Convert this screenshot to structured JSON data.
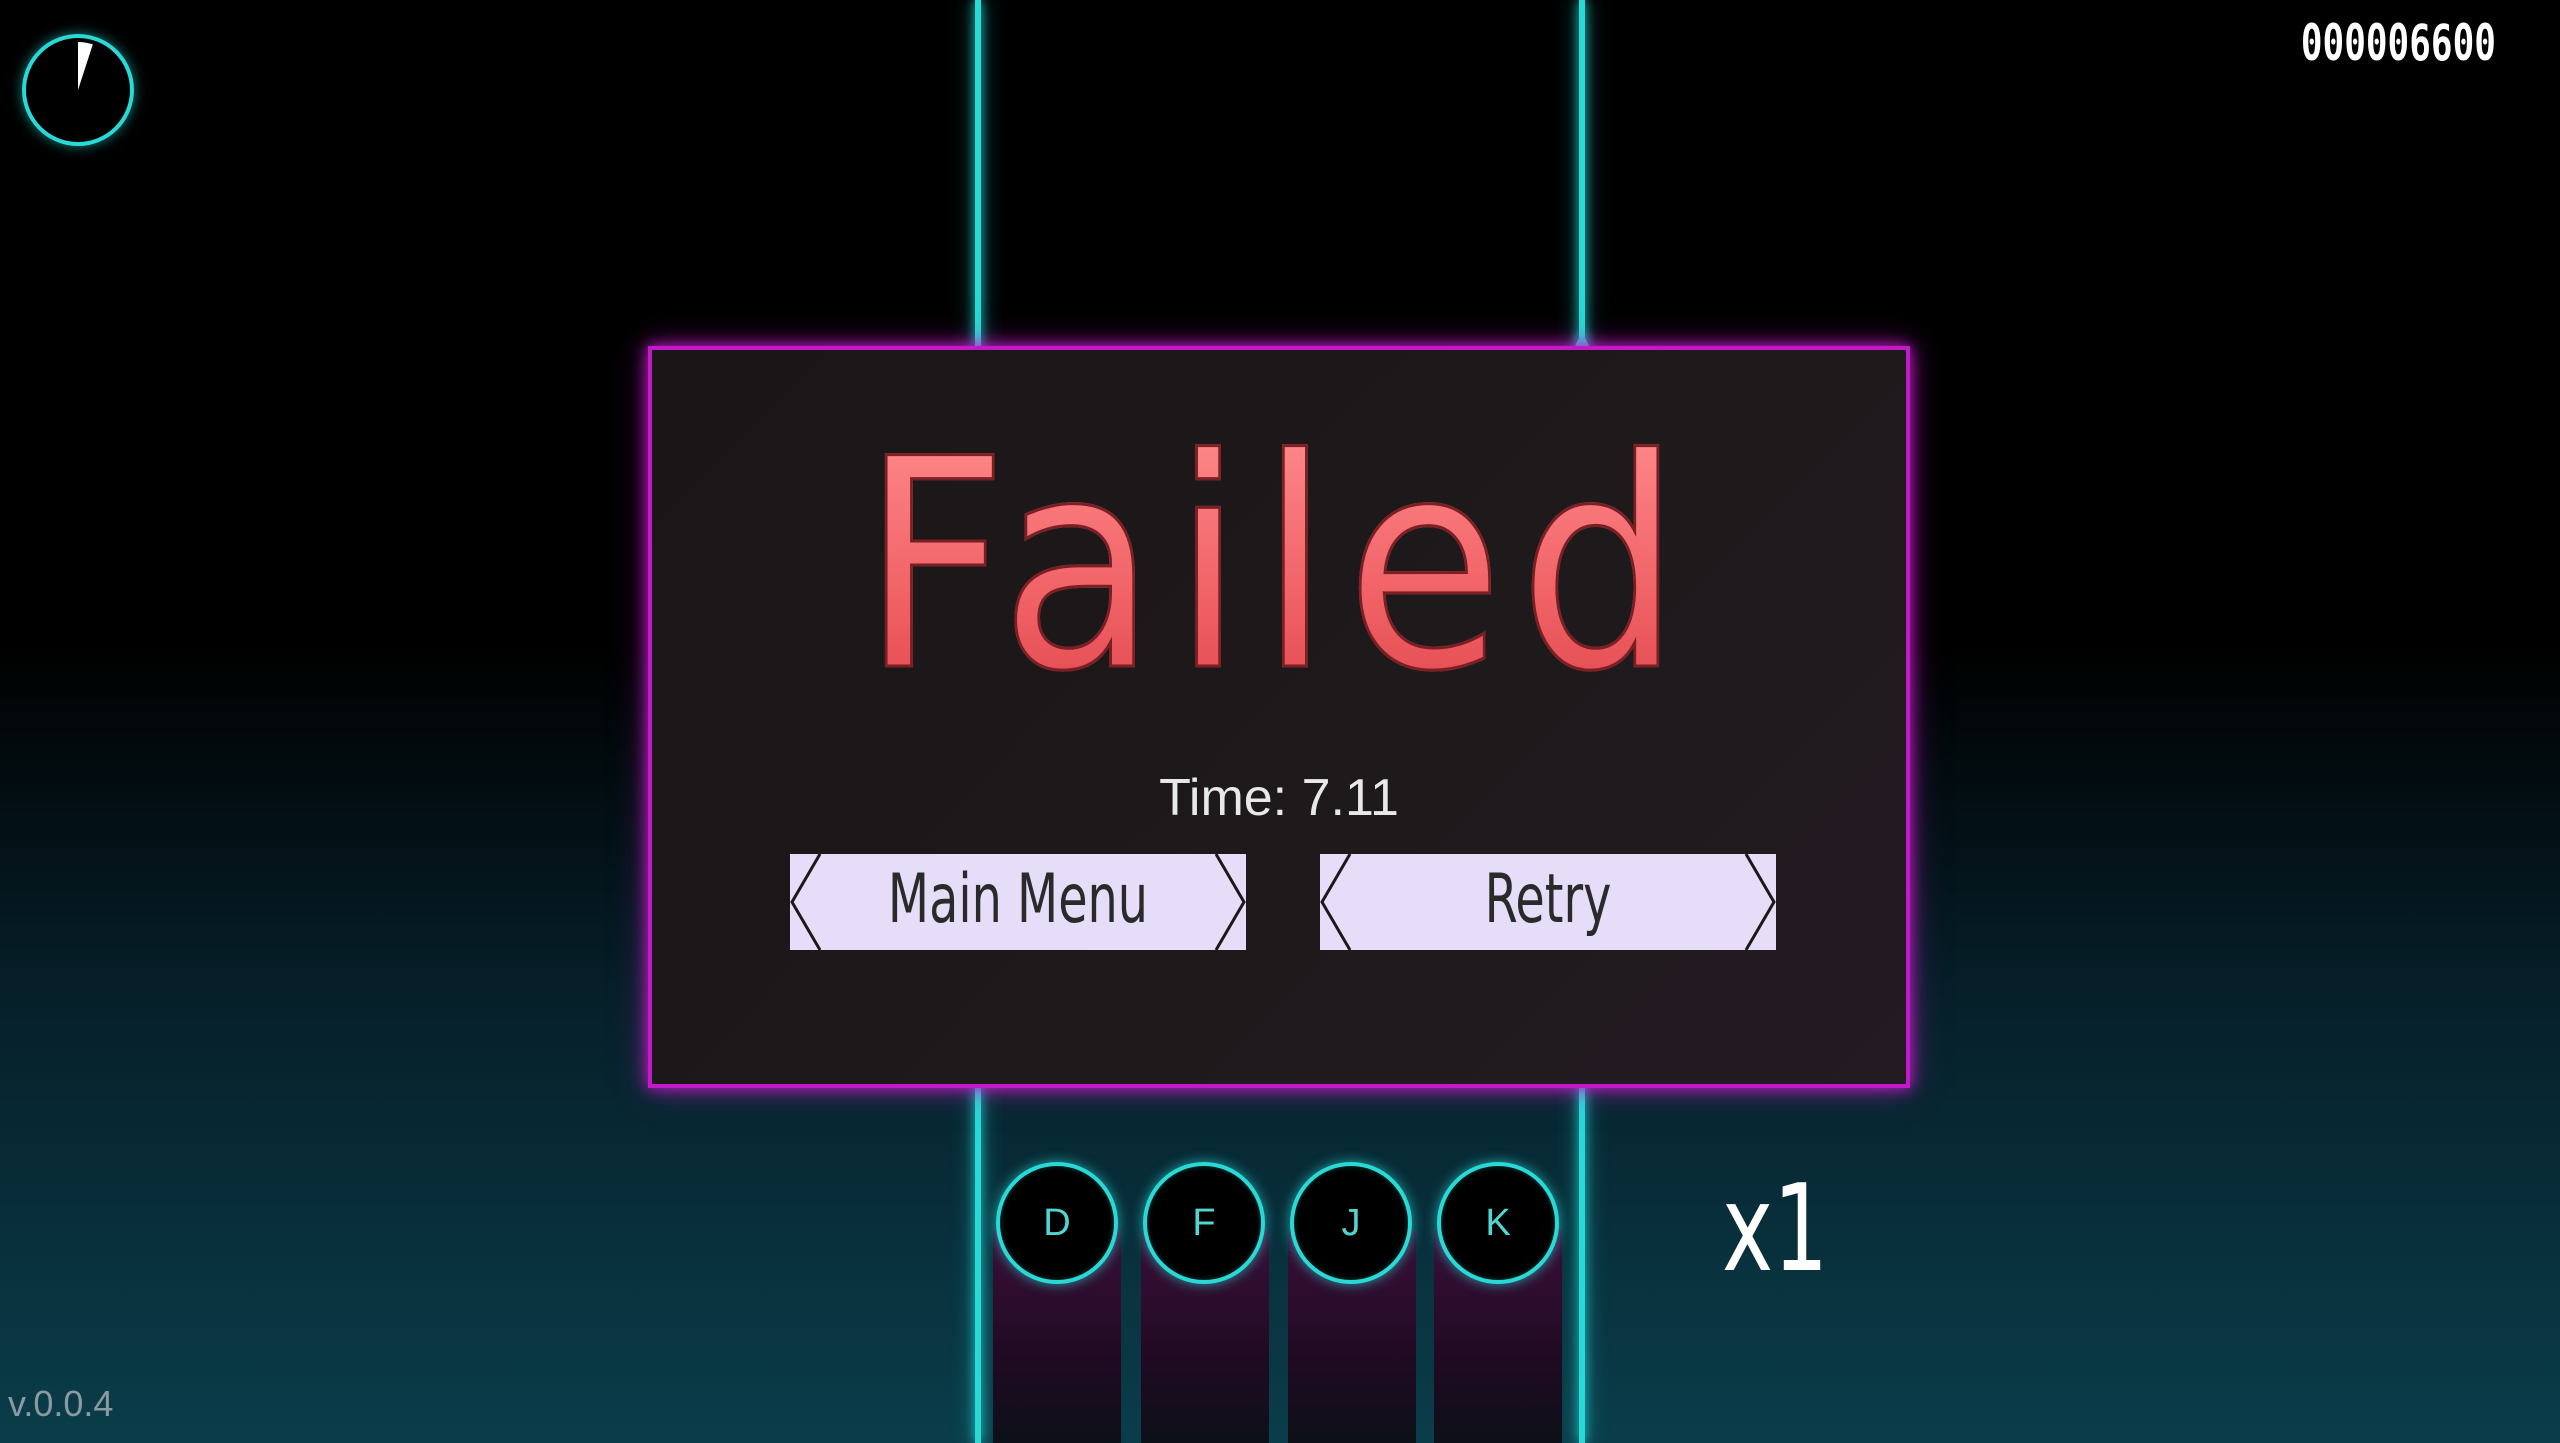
{
  "hud": {
    "score": "000006600",
    "version": "v.0.0.4",
    "multiplier": "x1",
    "timer_progress": 0.05
  },
  "result_panel": {
    "title": "Failed",
    "time_text": "Time: 7.11",
    "main_menu_label": "Main Menu",
    "retry_label": "Retry"
  },
  "lanes": {
    "keys": [
      "D",
      "F",
      "J",
      "K"
    ]
  },
  "colors": {
    "rail": "#28d9d6",
    "panel_border": "#c21ac8",
    "title": "#f06266",
    "button": "#e6ddf8"
  }
}
